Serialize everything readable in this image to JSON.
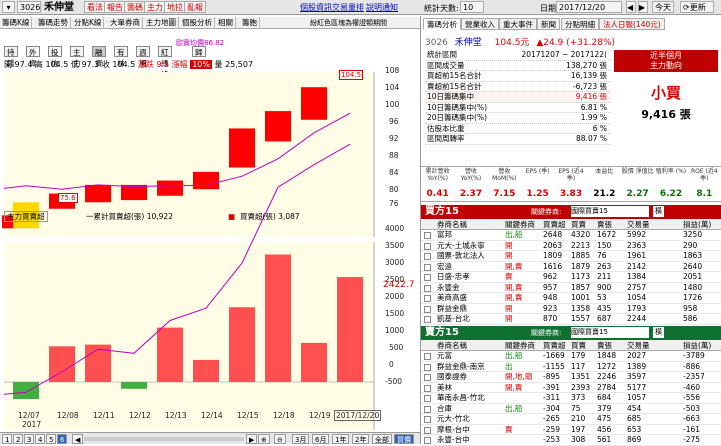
{
  "topbar": {
    "code": "3026",
    "name": "禾伸堂",
    "buttons": [
      "看法",
      "報告",
      "籌碼",
      "主力",
      "地拉",
      "亂報"
    ],
    "links": [
      "個股資訊",
      "交易量排",
      "說明通知"
    ],
    "days_label": "統計天數:",
    "days": "10",
    "date_label": "日期:",
    "date": "2017/12/20",
    "today": "今天",
    "refresh": "更新"
  },
  "tabs": [
    "籌碼K線",
    "籌碼走勢",
    "分點K線",
    "大單券商",
    "主力地圖",
    "個股分析",
    "相關",
    "籌胞"
  ],
  "tab_note": "紛紅色區塊為權證類期間",
  "tools": [
    "持錢",
    "外資",
    "投信",
    "主力",
    "融資",
    "有林",
    "週期",
    "紅綠條",
    "",
    "歸"
  ],
  "info": {
    "a_label": "開",
    "a": "97.4",
    "b_label": "高",
    "b": "104.5",
    "c_label": "低",
    "c": "97.3",
    "d_label": "收",
    "d": "104.5",
    "e_label": "漲跌",
    "e": "9.5",
    "f_label": "漲幅",
    "f": "10%",
    "g_label": "量",
    "g": "25,507"
  },
  "top_axis": [
    "108",
    "104",
    "100",
    "96",
    "92",
    "88",
    "84",
    "80",
    "76",
    "72"
  ],
  "top_markers": {
    "hi": "104.5",
    "lo": "75.6",
    "avg": "歐實均價86.82"
  },
  "lower_legend": {
    "title": "主力買賣超",
    "a": "一累計買賣超(張) 10,922",
    "b": "買賣超(張) 3,087"
  },
  "lower_axis": [
    "4000",
    "3500",
    "3000",
    "2500",
    "2000",
    "1500",
    "1000",
    "500",
    "0",
    "-500"
  ],
  "lower_value": "2422.7",
  "x_dates": [
    "12/07",
    "12/08",
    "12/11",
    "12/12",
    "12/13",
    "12/14",
    "12/15",
    "12/18",
    "12/19",
    "2017/12/20"
  ],
  "year": "2017",
  "bottom": {
    "pages": [
      "1",
      "2",
      "3",
      "4",
      "5",
      "6"
    ],
    "ranges": [
      "3月",
      "6月",
      "1年",
      "2年",
      "全部",
      "買價"
    ]
  },
  "right_tabs": [
    "籌碼分析",
    "營業收入",
    "重大事件",
    "新聞",
    "分點明細",
    "法人日報(140元)"
  ],
  "header": {
    "code": "3026",
    "name": "禾伸堂",
    "price": "104.5元",
    "chg": "▲24.9 (+31.28%)"
  },
  "stats": [
    [
      "統計區間",
      "20171207 ~ 2017122("
    ],
    [
      "區間成交量",
      "138,270 張"
    ],
    [
      "買超前15名合計",
      "16,139 張"
    ],
    [
      "賣超前15名合計",
      "-6,723 張"
    ],
    [
      "10日籌碼集中",
      "9,416 張"
    ],
    [
      "10日籌碼集中(%)",
      "6.81 %"
    ],
    [
      "20日籌碼集中(%)",
      "1.99 %"
    ],
    [
      "估股本比重",
      "6 %"
    ],
    [
      "區間周轉率",
      "88.07 %"
    ]
  ],
  "recent": {
    "title": "近半個月",
    "subtitle": "主力動向",
    "label": "小買",
    "value": "9,416 張"
  },
  "metrics": {
    "heads": [
      "累計營收 YoY(%)",
      "營收 YoY(%)",
      "營收 MoM(%)",
      "EPS (季)",
      "EPS (近4季)",
      "本益比",
      "股價 淨值比",
      "殖利率 (%)",
      "ROE (近4季)"
    ],
    "vals": [
      "0.41",
      "2.37",
      "7.15",
      "1.25",
      "3.83",
      "21.2",
      "2.27",
      "6.22",
      "8.1"
    ]
  },
  "buy": {
    "title": "買方15",
    "filter": "關鍵券商:",
    "select": "國際買賣15",
    "btn": "橫",
    "heads": [
      "券商名稱",
      "關鍵券商",
      "買賣超",
      "買賣",
      "賣張",
      "交易量",
      "損益(萬)"
    ],
    "rows": [
      [
        "富邦",
        "出,船",
        "2648",
        "4320",
        "1672",
        "5992",
        "3250"
      ],
      [
        "元大-土城永寧",
        "開",
        "2063",
        "2213",
        "150",
        "2363",
        "290"
      ],
      [
        "國票-敦北法人",
        "開",
        "1809",
        "1885",
        "76",
        "1961",
        "1863"
      ],
      [
        "宏遠",
        "開,賣",
        "1616",
        "1879",
        "263",
        "2142",
        "2640"
      ],
      [
        "日盛-忠孝",
        "賣",
        "962",
        "1173",
        "211",
        "1384",
        "2051"
      ],
      [
        "永豐金",
        "開,賣",
        "957",
        "1857",
        "900",
        "2757",
        "1480"
      ],
      [
        "美商高盛",
        "開,賣",
        "948",
        "1001",
        "53",
        "1054",
        "1726"
      ],
      [
        "群益金鼎",
        "開",
        "923",
        "1358",
        "435",
        "1793",
        "958"
      ],
      [
        "凱基-台北",
        "開",
        "870",
        "1557",
        "687",
        "2244",
        "586"
      ]
    ]
  },
  "sell": {
    "title": "賣方15",
    "filter": "關鍵券商:",
    "select": "國際買賣15",
    "btn": "橫",
    "heads": [
      "券商名稱",
      "關鍵券商",
      "買賣超",
      "買賣",
      "賣張",
      "交易量",
      "損益(萬)"
    ],
    "rows": [
      [
        "元富",
        "出,船",
        "-1669",
        "179",
        "1848",
        "2027",
        "-3789"
      ],
      [
        "群益金鼎-南京",
        "出",
        "-1155",
        "117",
        "1272",
        "1389",
        "-886"
      ],
      [
        "國泰證券",
        "開,地,頭",
        "-895",
        "1351",
        "2246",
        "3597",
        "-2357"
      ],
      [
        "美林",
        "開,賣",
        "-391",
        "2393",
        "2784",
        "5177",
        "-460"
      ],
      [
        "華南永昌-竹北",
        "",
        "-311",
        "373",
        "684",
        "1057",
        "-556"
      ],
      [
        "合庫",
        "出,船",
        "-304",
        "75",
        "379",
        "454",
        "-503"
      ],
      [
        "元大-竹北",
        "",
        "-265",
        "210",
        "475",
        "685",
        "-663"
      ],
      [
        "摩根-台中",
        "賣",
        "-259",
        "197",
        "456",
        "653",
        "-161"
      ],
      [
        "永豐-台中",
        "",
        "-253",
        "308",
        "561",
        "869",
        "-275"
      ]
    ]
  }
}
